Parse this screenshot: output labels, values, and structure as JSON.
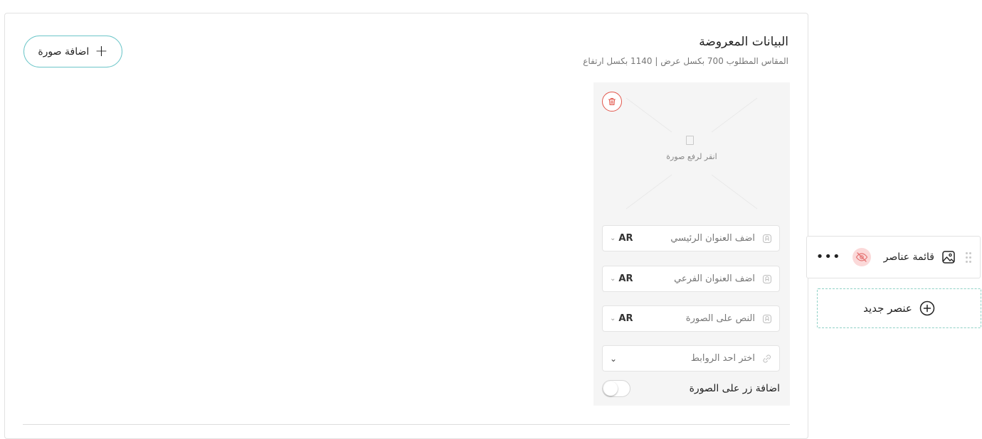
{
  "panel": {
    "title": "البيانات المعروضة",
    "subtitle": "المقاس المطلوب 700 بكسل عرض | 1140 بكسل ارتفاع",
    "add_image_label": "اضافة صورة"
  },
  "card": {
    "upload_text": "انقر لرفع صورة",
    "fields": [
      {
        "placeholder": "اضف العنوان الرئيسي",
        "lang": "AR"
      },
      {
        "placeholder": "اضف العنوان الفرعي",
        "lang": "AR"
      },
      {
        "placeholder": "النص على الصورة",
        "lang": "AR"
      }
    ],
    "link_placeholder": "اختر احد الروابط",
    "toggle_label": "اضافة زر على الصورة",
    "toggle_on": false
  },
  "sidebar": {
    "item_label": "قائمة عناصر",
    "more_label": "•••",
    "new_element_label": "عنصر جديد"
  },
  "icons": {
    "add": "plus-icon",
    "delete": "trash-icon",
    "upload": "image-upload-icon",
    "field": "text-field-icon",
    "link": "link-icon",
    "chevron": "chevron-down-icon",
    "drag": "drag-handle-icon",
    "item": "image-icon",
    "visibility": "eye-off-icon",
    "new": "plus-circle-icon"
  },
  "colors": {
    "accent": "#6cc6c9",
    "danger": "#e2574c",
    "danger_bg": "#fbd9d9",
    "dashed_border": "#8fd1c6",
    "card_bg": "#f5f5f5"
  }
}
